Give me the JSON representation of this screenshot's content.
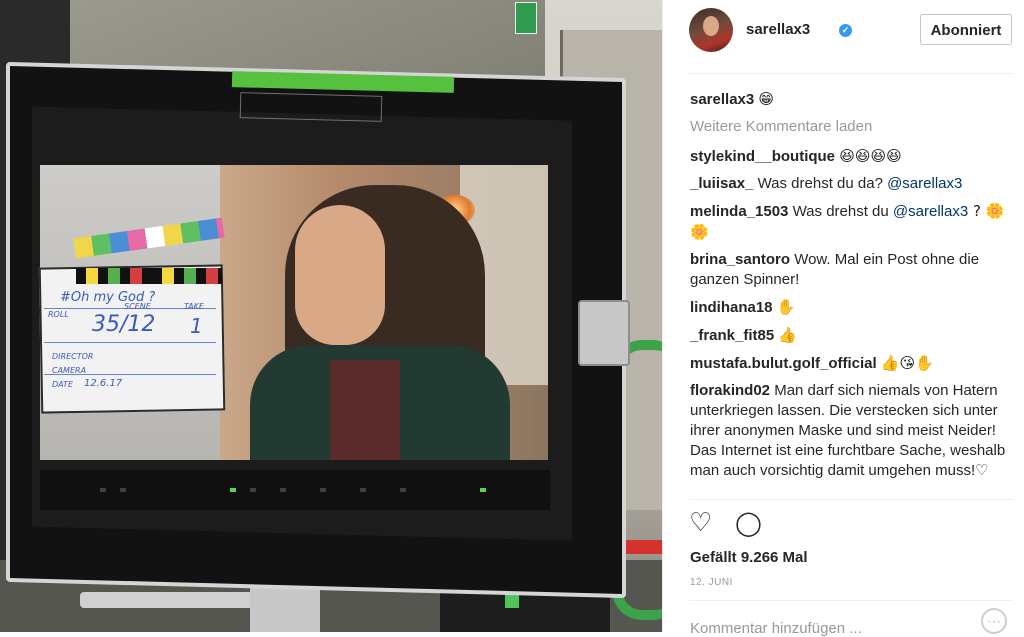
{
  "post": {
    "image_alt": "",
    "slate": {
      "title": "#Oh my God ?",
      "roll_label": "ROLL",
      "scene_label": "SCENE",
      "take_label": "TAKE",
      "scene_value": "35/12",
      "take_value": "1",
      "director_label": "DIRECTOR",
      "camera_label": "CAMERA",
      "date_label": "DATE",
      "date_value": "12.6.17"
    },
    "tape_text": "",
    "gear_tag": ""
  },
  "header": {
    "username": "sarellax3",
    "verified_icon": "verified-badge-icon",
    "follow_label": "Abonniert"
  },
  "caption": {
    "user": "sarellax3",
    "text": "😁"
  },
  "load_more_label": "Weitere Kommentare laden",
  "comments": [
    {
      "user": "stylekind__boutique",
      "text": "😆😆😆😆"
    },
    {
      "user": "_luiisax_",
      "text": "Was drehst du da? ",
      "mention": "@sarellax3"
    },
    {
      "user": "melinda_1503",
      "text": "Was drehst du ",
      "mention": "@sarellax3",
      "after": " ? 🌼🌼"
    },
    {
      "user": "brina_santoro",
      "text": "Wow. Mal ein Post ohne die ganzen Spinner!"
    },
    {
      "user": "lindihana18",
      "text": "✋"
    },
    {
      "user": "_frank_fit85",
      "text": "👍"
    },
    {
      "user": "mustafa.bulut.golf_official",
      "text": "👍😘✋"
    },
    {
      "user": "florakind02",
      "text": "Man darf sich niemals von Hatern unterkriegen lassen. Die verstecken sich unter ihrer anonymen Maske und sind meist Neider! Das Internet ist eine furchtbare Sache, weshalb man auch vorsichtig damit umgehen muss!♡"
    }
  ],
  "actions": {
    "like_icon": "heart-icon",
    "like_glyph": "♡",
    "comment_icon": "comment-bubble-icon",
    "comment_glyph": "◯"
  },
  "likes_label": "Gefällt 9.266 Mal",
  "date_label": "12. JUNI",
  "comment_placeholder": "Kommentar hinzufügen ...",
  "more_icon": "more-options-icon",
  "colors": {
    "text": "#262626",
    "muted": "#999999",
    "mention": "#003569",
    "verified": "#3897f0",
    "divider": "#efefef"
  }
}
